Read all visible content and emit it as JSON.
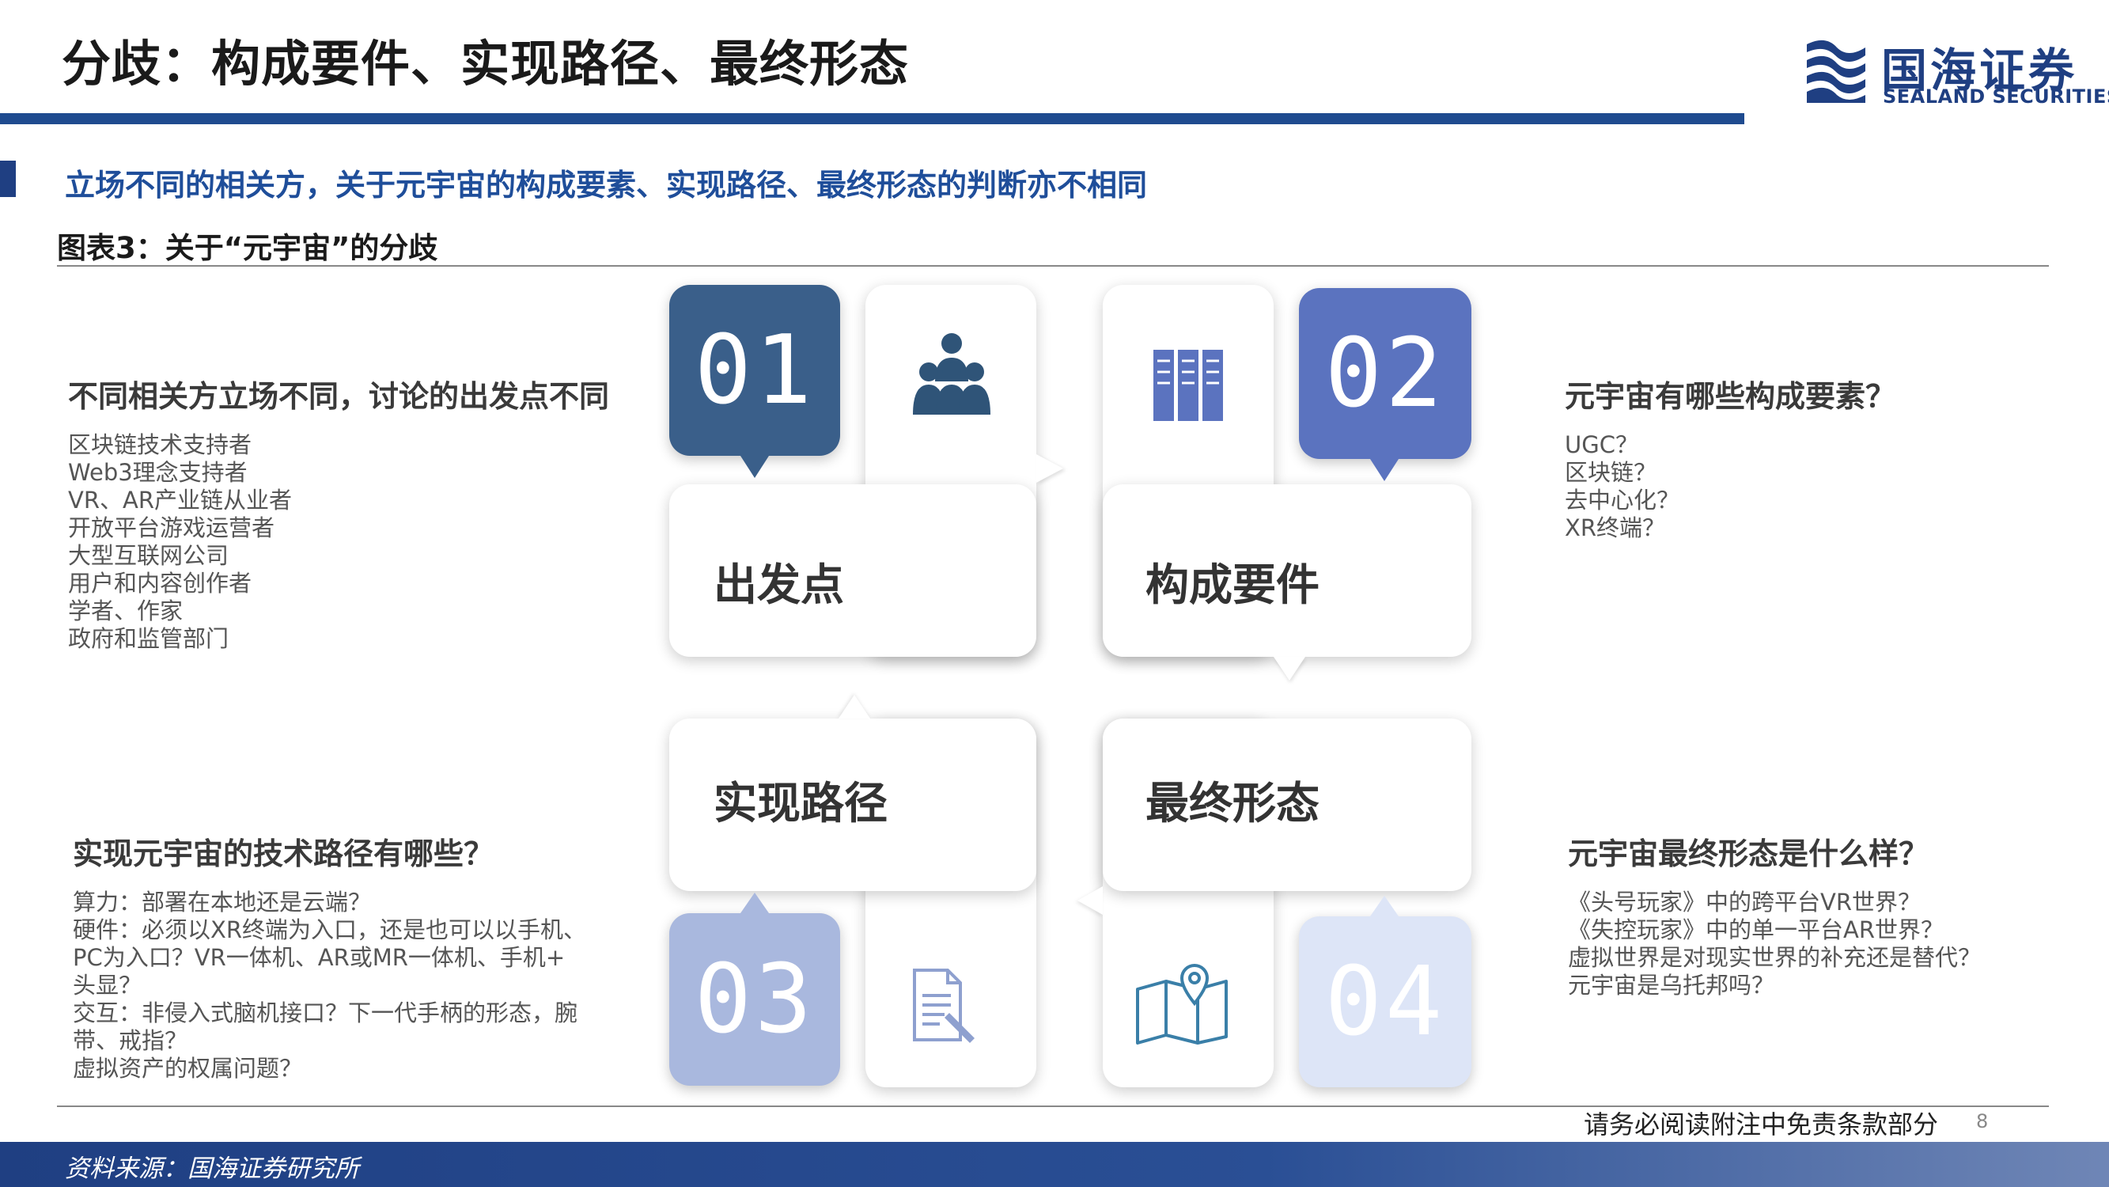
{
  "header": {
    "title": "分歧：构成要件、实现路径、最终形态",
    "logo_name": "国海证券",
    "logo_en": "SEALAND SECURITIES",
    "accent_color": "#1f4b8f"
  },
  "subtitle": "立场不同的相关方，关于元宇宙的构成要素、实现路径、最终形态的判断亦不相同",
  "figure_caption": "图表3：关于“元宇宙”的分歧",
  "cards": [
    {
      "number": "01",
      "label": "出发点",
      "icon": "people-group-icon",
      "color": "#3a5f8a"
    },
    {
      "number": "02",
      "label": "构成要件",
      "icon": "bookshelf-icon",
      "color": "#5b73bf"
    },
    {
      "number": "03",
      "label": "实现路径",
      "icon": "document-edit-icon",
      "color": "#a9b8de"
    },
    {
      "number": "04",
      "label": "最终形态",
      "icon": "map-location-icon",
      "color": "#dde5f7"
    }
  ],
  "sections": {
    "starting_point": {
      "title": "不同相关方立场不同，讨论的出发点不同",
      "items": [
        "区块链技术支持者",
        "Web3理念支持者",
        "VR、AR产业链从业者",
        "开放平台游戏运营者",
        "大型互联网公司",
        "用户和内容创作者",
        "学者、作家",
        "政府和监管部门"
      ]
    },
    "components": {
      "title": "元宇宙有哪些构成要素？",
      "items": [
        "UGC？",
        "区块链？",
        "去中心化？",
        "XR终端？"
      ]
    },
    "path": {
      "title": "实现元宇宙的技术路径有哪些？",
      "items": [
        "算力：部署在本地还是云端？",
        "硬件：必须以XR终端为入口，还是也可以以手机、",
        "PC为入口？VR一体机、AR或MR一体机、手机+",
        "头显？",
        "交互：非侵入式脑机接口？下一代手柄的形态，腕",
        "带、戒指？",
        "虚拟资产的权属问题？"
      ]
    },
    "final_form": {
      "title": "元宇宙最终形态是什么样？",
      "items": [
        "《头号玩家》中的跨平台VR世界？",
        "《失控玩家》中的单一平台AR世界？",
        "虚拟世界是对现实世界的补充还是替代？",
        "元宇宙是乌托邦吗？"
      ]
    }
  },
  "footer": {
    "disclaimer": "请务必阅读附注中免责条款部分",
    "page_number": "8",
    "source": "资料来源：国海证券研究所"
  }
}
